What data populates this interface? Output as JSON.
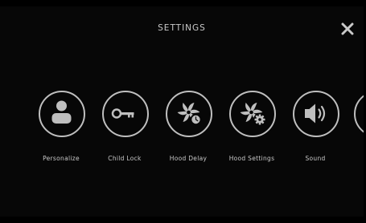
{
  "header": {
    "title": "SETTINGS",
    "close_icon": "close-icon"
  },
  "settings_items": [
    {
      "label": "Personalize",
      "icon": "person-icon"
    },
    {
      "label": "Child Lock",
      "icon": "key-icon"
    },
    {
      "label": "Hood Delay",
      "icon": "fan-timer-icon"
    },
    {
      "label": "Hood Settings",
      "icon": "fan-gear-icon"
    },
    {
      "label": "Sound",
      "icon": "speaker-icon"
    }
  ],
  "colors": {
    "background": "#070707",
    "foreground": "#c9c9c9",
    "icon": "#bfbfbf"
  }
}
